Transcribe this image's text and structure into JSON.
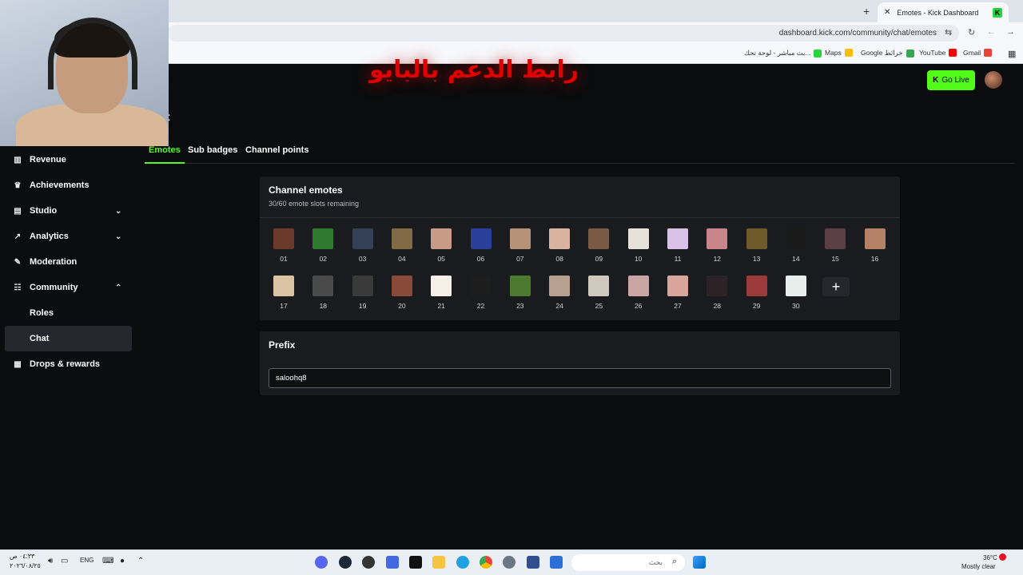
{
  "browser": {
    "tab_title": "Emotes - Kick Dashboard",
    "tab_close": "✕",
    "new_tab": "+",
    "url": "dashboard.kick.com/community/chat/emotes",
    "bookmarks": [
      "Gmail",
      "YouTube",
      "Google خرائط",
      "Maps",
      "بث مباشر - لوحة تحك..."
    ]
  },
  "overlay": {
    "banner_text": "رابط الدعم بالبايو"
  },
  "header": {
    "go_live_label": "Go Live",
    "title_fragment": "t"
  },
  "sidebar": {
    "items": [
      {
        "label": "Revenue",
        "icon": "revenue-icon"
      },
      {
        "label": "Achievements",
        "icon": "trophy-icon"
      },
      {
        "label": "Studio",
        "icon": "studio-icon"
      },
      {
        "label": "Analytics",
        "icon": "analytics-icon"
      },
      {
        "label": "Moderation",
        "icon": "moderation-icon"
      },
      {
        "label": "Community",
        "icon": "community-icon"
      },
      {
        "label": "Roles"
      },
      {
        "label": "Chat"
      },
      {
        "label": "Drops & rewards",
        "icon": "drops-icon"
      }
    ]
  },
  "tabs": [
    "Emotes",
    "Sub badges",
    "Channel points"
  ],
  "emotes_card": {
    "title": "Channel emotes",
    "subtitle": "30/60 emote slots remaining",
    "emotes": [
      "01",
      "02",
      "03",
      "04",
      "05",
      "06",
      "07",
      "08",
      "09",
      "10",
      "11",
      "12",
      "13",
      "14",
      "15",
      "16",
      "17",
      "18",
      "19",
      "20",
      "21",
      "22",
      "23",
      "24",
      "25",
      "26",
      "27",
      "28",
      "29",
      "30"
    ],
    "add_label": "+"
  },
  "prefix_card": {
    "title": "Prefix",
    "value": "saloohq8"
  },
  "taskbar": {
    "search_placeholder": "بحث",
    "lang": "ENG",
    "time": "٠٤:٣٣ ص",
    "date": "٢٠٢٦/٠٨/٢٥",
    "weather_temp": "36°C",
    "weather_desc": "Mostly clear"
  },
  "colors": {
    "accent": "#53fc18",
    "banner": "#e00000",
    "card_bg": "#191b1f",
    "page_bg": "#0b0c0d"
  }
}
